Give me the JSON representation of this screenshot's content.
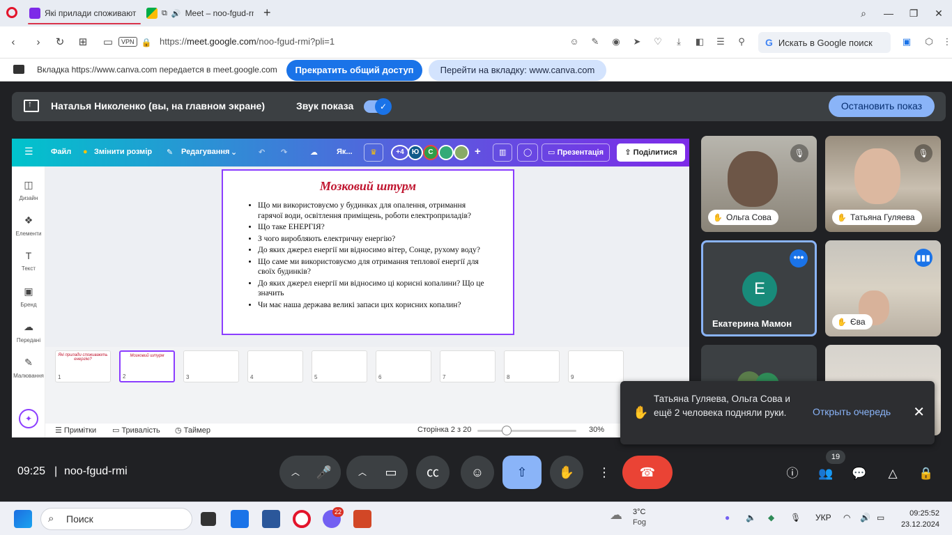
{
  "tabs": [
    {
      "title": "Які прилади споживають"
    },
    {
      "title": "Meet – noo-fgud-rmi"
    }
  ],
  "address": {
    "url_prefix": "https://",
    "url_host": "meet.google.com",
    "url_path": "/noo-fgud-rmi?pli=1",
    "vpn_label": "VPN",
    "search_placeholder": "Искать в Google поиск",
    "google_letter": "G"
  },
  "share_bar": {
    "message": "Вкладка https://www.canva.com передается в meet.google.com",
    "stop_label": "Прекратить общий доступ",
    "goto_label": "Перейти на вкладку: www.canva.com"
  },
  "presenting": {
    "name": "Наталья Николенко (вы, на главном экране)",
    "sound_label": "Звук показа",
    "stop_label": "Остановить показ"
  },
  "canva": {
    "menu": {
      "file": "Файл",
      "resize": "Змінити розмір",
      "editing": "Редагування",
      "title_short": "Як...",
      "plus_count": "+4",
      "avatar1": "Ю",
      "avatar2": "С",
      "present": "Презентація",
      "share": "Поділитися"
    },
    "sidebar": [
      "Дизайн",
      "Елементи",
      "Текст",
      "Бренд",
      "Передані",
      "Малювання"
    ],
    "slide": {
      "title": "Мозковий штурм",
      "bullets": [
        "Що ми використовуємо у будинках для опалення, отримання гарячої води, освітлення приміщень, роботи електроприладів?",
        "Що таке ЕНЕРГІЯ?",
        "З чого виробляють електричну енергію?",
        "До яких джерел енергії ми відносимо вітер, Сонце, рухому воду?",
        "Що саме ми використовуємо для отримання теплової енергії для своїх будинків?",
        "До яких джерел енергії ми відносимо ці корисні копалини? Що це значить",
        "Чи має наша держава великі запаси цих корисних копалин?"
      ]
    },
    "thumbs": [
      {
        "num": "1",
        "title": "Які прилади споживають енергію?"
      },
      {
        "num": "2",
        "title": "Мозковий штурм"
      },
      {
        "num": "3",
        "title": ""
      },
      {
        "num": "4",
        "title": ""
      },
      {
        "num": "5",
        "title": ""
      },
      {
        "num": "6",
        "title": ""
      },
      {
        "num": "7",
        "title": ""
      },
      {
        "num": "8",
        "title": ""
      },
      {
        "num": "9",
        "title": ""
      }
    ],
    "bottom": {
      "notes": "Примітки",
      "duration": "Тривалість",
      "timer": "Таймер",
      "page": "Сторінка 2 з 20",
      "zoom": "30%"
    }
  },
  "participants": [
    {
      "name": "Ольга Сова"
    },
    {
      "name": "Татьяна Гуляева"
    },
    {
      "name": "Екатерина Мамон",
      "initial": "Е"
    },
    {
      "name": "Єва"
    }
  ],
  "notification": {
    "message": "Татьяна Гуляева, Ольга Сова и ещё 2 человека подняли руки.",
    "action": "Открыть очередь"
  },
  "meet_bar": {
    "time": "09:25",
    "separator": "|",
    "code": "noo-fgud-rmi",
    "people_count": "19"
  },
  "taskbar": {
    "search": "Поиск",
    "viber_badge": "22",
    "weather_temp": "3°C",
    "weather_cond": "Fog",
    "lang": "УКР",
    "time": "09:25:52",
    "date": "23.12.2024"
  }
}
